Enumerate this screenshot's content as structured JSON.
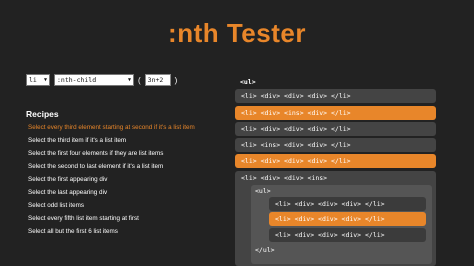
{
  "page": {
    "title": ":nth Tester"
  },
  "controls": {
    "element_select": "li",
    "pseudo_select": ":nth-child",
    "open_paren": "(",
    "formula_value": "3n+2",
    "close_paren": ")"
  },
  "recipes": {
    "heading": "Recipes",
    "items": [
      "Select every third element starting at second if it's a list item",
      "Select the third item if it's a list item",
      "Select the first four elements if they are list items",
      "Select the second to last element if it's a list item",
      "Select the first appearing div",
      "Select the last appearing div",
      "Select odd list items",
      "Select every fifth list item starting at first",
      "Select all but the first 6 list items"
    ]
  },
  "markup": {
    "ul_open": "<ul>",
    "rows": [
      {
        "text": "<li>  <div>  <div>  <div>  </li>",
        "highlighted": false
      },
      {
        "text": "<li>  <div>  <ins>  <div>  </li>",
        "highlighted": true
      },
      {
        "text": "<li>  <div>  <div>  <div>  </li>",
        "highlighted": false
      },
      {
        "text": "<li>  <ins>  <div>  <div>  </li>",
        "highlighted": false
      },
      {
        "text": "<li>  <div>  <div>  <div>  </li>",
        "highlighted": true
      }
    ],
    "nested_header": "<li>  <div>  <div>  <ins>",
    "nested_ul_open": "<ul>",
    "nested_rows": [
      {
        "text": "<li>  <div>  <div>  <div>  </li>",
        "highlighted": false
      },
      {
        "text": "<li>  <div>  <div>  <div>  </li>",
        "highlighted": true
      },
      {
        "text": "<li>  <div>  <div>  <div>  </li>",
        "highlighted": false
      }
    ],
    "nested_ul_close": "</ul>"
  },
  "colors": {
    "accent": "#e8862a",
    "background": "#222222"
  }
}
